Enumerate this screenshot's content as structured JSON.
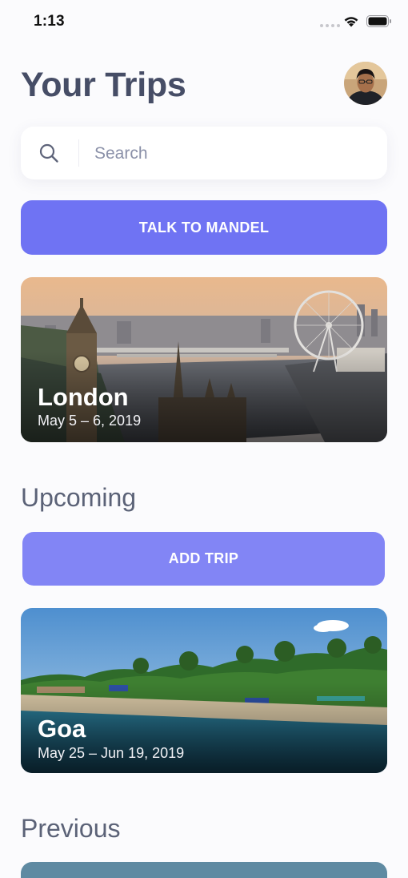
{
  "status_bar": {
    "time": "1:13"
  },
  "header": {
    "title": "Your Trips"
  },
  "search": {
    "placeholder": "Search",
    "value": ""
  },
  "actions": {
    "talk_label": "TALK TO MANDEL",
    "add_trip_label": "ADD TRIP"
  },
  "featured_trip": {
    "city": "London",
    "dates": "May 5 – 6, 2019"
  },
  "sections": {
    "upcoming": "Upcoming",
    "previous": "Previous"
  },
  "upcoming_trips": [
    {
      "city": "Goa",
      "dates": "May 25 – Jun 19, 2019"
    }
  ],
  "colors": {
    "accent": "#6f73f3",
    "accent_light": "#8285f5",
    "title_text": "#464d66",
    "background": "#fbfbfd"
  },
  "icons": {
    "search": "search-icon",
    "wifi": "wifi-icon",
    "battery": "battery-icon",
    "avatar": "avatar"
  }
}
